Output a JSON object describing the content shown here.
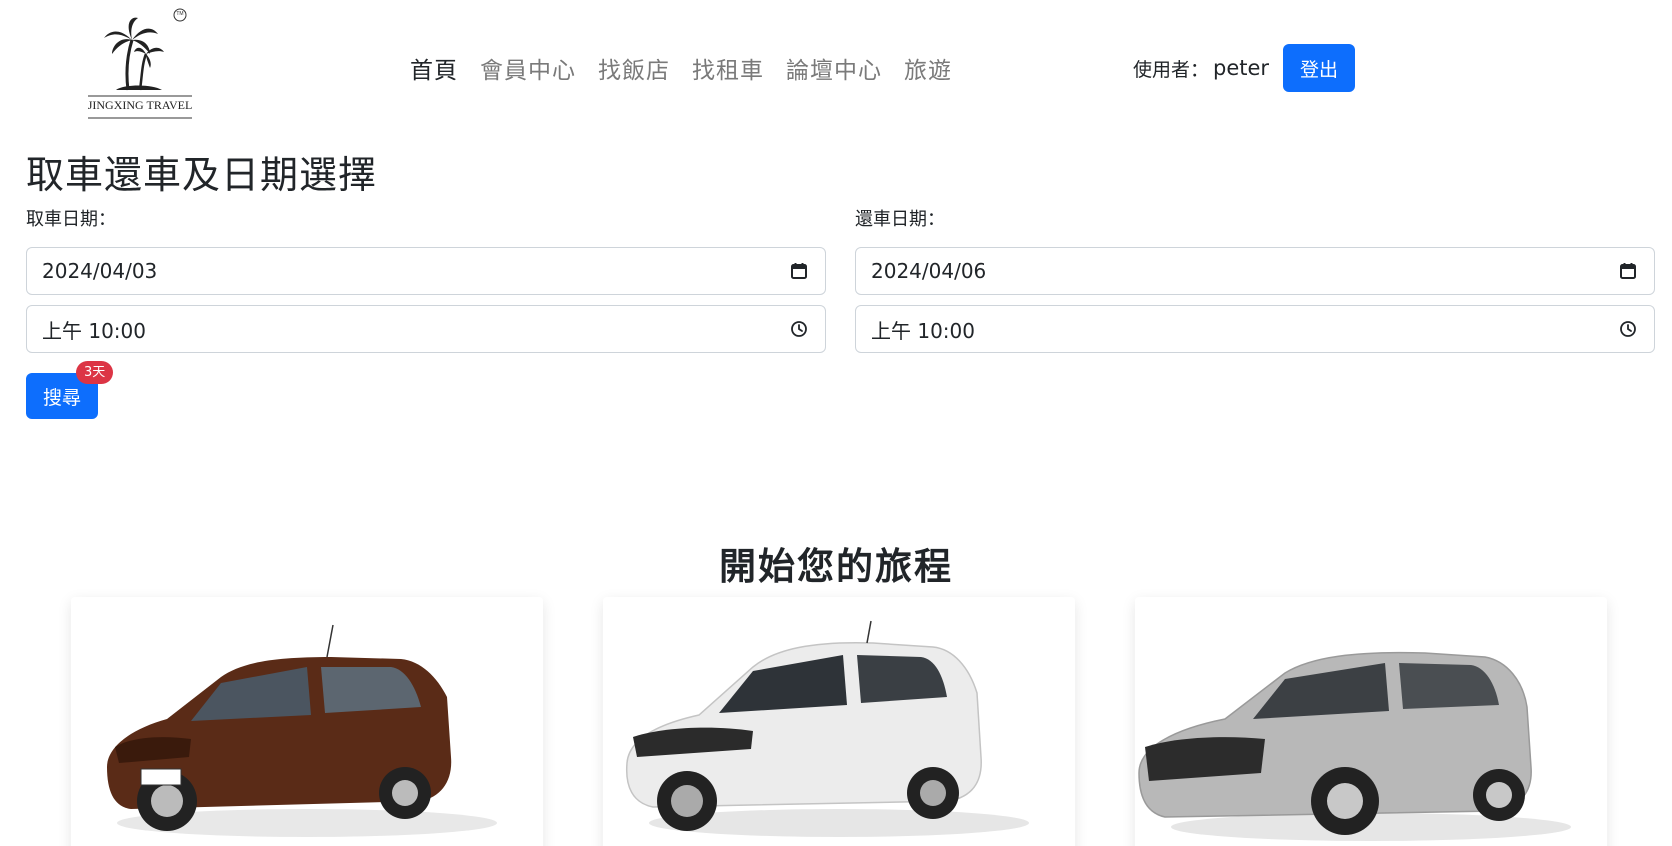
{
  "brand": {
    "logo_text": "JINGXING TRAVEL",
    "trademark": "TM",
    "icon": "palm-tree-logo"
  },
  "nav": {
    "items": [
      {
        "label": "首頁",
        "active": true
      },
      {
        "label": "會員中心",
        "active": false
      },
      {
        "label": "找飯店",
        "active": false
      },
      {
        "label": "找租車",
        "active": false
      },
      {
        "label": "論壇中心",
        "active": false
      },
      {
        "label": "旅遊",
        "active": false
      }
    ]
  },
  "user": {
    "label": "使用者：",
    "name": "peter",
    "logout_label": "登出"
  },
  "page_title": "取車還車及日期選擇",
  "pickup": {
    "label": "取車日期：",
    "date": "2024/04/03",
    "time": "上午 10:00",
    "date_icon": "calendar-icon",
    "time_icon": "clock-icon"
  },
  "return": {
    "label": "還車日期：",
    "date": "2024/04/06",
    "time": "上午 10:00",
    "date_icon": "calendar-icon",
    "time_icon": "clock-icon"
  },
  "search": {
    "label": "搜尋",
    "badge": "3天"
  },
  "section_title": "開始您的旅程",
  "cards": [
    {
      "image": "brown-toyota-vitz-hatchback",
      "color": "#5a2b17"
    },
    {
      "image": "white-honda-fit-hatchback",
      "color": "#ececec"
    },
    {
      "image": "silver-hatchback",
      "color": "#b5b5b5"
    }
  ],
  "colors": {
    "primary": "#0d6efd",
    "badge": "#dc3545",
    "text": "#212529",
    "muted": "#7a7a7a",
    "border": "#ced4da"
  }
}
